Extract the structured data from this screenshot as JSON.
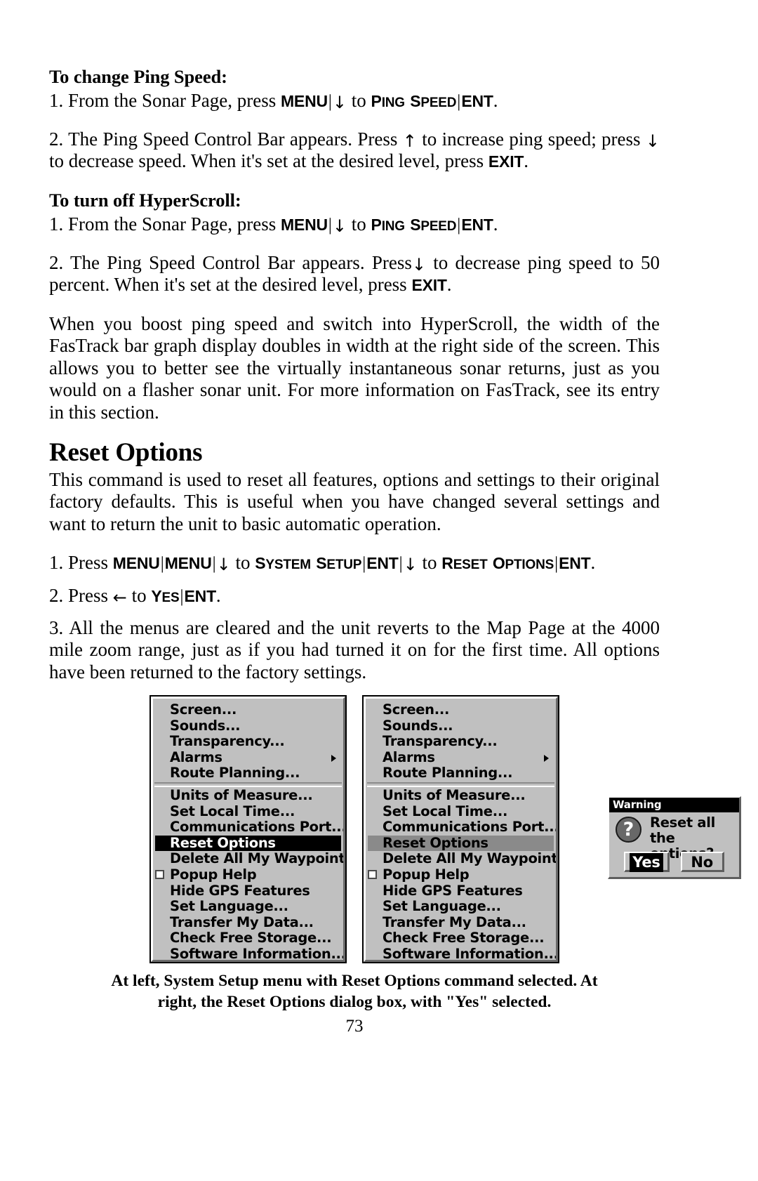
{
  "sections": [
    {
      "heading": "To change Ping Speed:",
      "steps": [
        {
          "prefix": "1. From the Sonar Page, press ",
          "keys": [
            "MENU",
            "↓",
            "PING SPEED",
            "ENT"
          ],
          "mid": " to ",
          "suffix": "."
        },
        {
          "text_full": "2. The Ping Speed Control Bar appears. Press ↑ to increase ping speed; press ↓ to decrease speed. When it's set at the desired level, press EXIT."
        }
      ]
    },
    {
      "heading": "To turn off HyperScroll:",
      "steps": [
        {
          "prefix": "1. From the Sonar Page, press ",
          "keys": [
            "MENU",
            "↓",
            "PING SPEED",
            "ENT"
          ],
          "mid": " to ",
          "suffix": "."
        },
        {
          "text_full": "2. The Ping Speed Control Bar appears. Press↓ to decrease ping speed to 50 percent. When it's set at the desired level, press EXIT."
        }
      ]
    }
  ],
  "paragraph_hyperscroll": "When you boost ping speed and switch into HyperScroll, the width of the FasTrack bar graph display doubles in width at the right side of the screen. This allows you to better see the virtually instantaneous sonar returns, just as you would on a flasher sonar unit. For more information on FasTrack, see its entry in this section.",
  "reset_section": {
    "title": "Reset Options",
    "intro": "This command is used to reset all features, options and settings to their original factory defaults. This is useful when you have changed several settings and want to return the unit to basic automatic operation.",
    "step1": {
      "prefix": "1. Press ",
      "k_menu1": "MENU",
      "k_menu2": "MENU",
      "k_down1": "↓",
      "to1": " to ",
      "k_system_setup": "SYSTEM SETUP",
      "k_ent1": "ENT",
      "k_down2": "↓",
      "to2": " to ",
      "k_reset_options": "RESET OPTIONS",
      "k_ent2": "ENT",
      "suffix": "."
    },
    "step2": {
      "prefix": "2. Press ",
      "arrow": "←",
      "mid": " to ",
      "k_yes": "YES",
      "k_ent": "ENT",
      "suffix": "."
    },
    "step3": "3. All the menus are cleared and the unit reverts to the Map Page at the 4000 mile zoom range, just as if you had turned it on for the first time. All options have been returned to the factory settings."
  },
  "menu": {
    "group1": [
      {
        "label": "Screen...",
        "submenu": false,
        "checkbox": false
      },
      {
        "label": "Sounds...",
        "submenu": false,
        "checkbox": false
      },
      {
        "label": "Transparency...",
        "submenu": false,
        "checkbox": false
      },
      {
        "label": "Alarms",
        "submenu": true,
        "checkbox": false
      },
      {
        "label": "Route Planning...",
        "submenu": false,
        "checkbox": false
      }
    ],
    "group2": [
      {
        "label": "Units of Measure...",
        "submenu": false,
        "checkbox": false,
        "selected": false
      },
      {
        "label": "Set Local Time...",
        "submenu": false,
        "checkbox": false,
        "selected": false
      },
      {
        "label": "Communications Port...",
        "submenu": false,
        "checkbox": false,
        "selected": false
      },
      {
        "label": "Reset Options",
        "submenu": false,
        "checkbox": false,
        "selected": true
      },
      {
        "label": "Delete All My Waypoints",
        "submenu": false,
        "checkbox": false,
        "selected": false
      },
      {
        "label": "Popup Help",
        "submenu": false,
        "checkbox": true,
        "selected": false
      },
      {
        "label": "Hide GPS Features",
        "submenu": false,
        "checkbox": false,
        "selected": false
      },
      {
        "label": "Set Language...",
        "submenu": false,
        "checkbox": false,
        "selected": false
      },
      {
        "label": "Transfer My Data...",
        "submenu": false,
        "checkbox": false,
        "selected": false
      },
      {
        "label": "Check Free Storage...",
        "submenu": false,
        "checkbox": false,
        "selected": false
      },
      {
        "label": "Software Information...",
        "submenu": false,
        "checkbox": false,
        "selected": false
      }
    ]
  },
  "dialog": {
    "title": "Warning",
    "icon": "question-mark",
    "message_line1": "Reset all the",
    "message_line2": "options?",
    "yes_label": "Yes",
    "no_label": "No",
    "selected_button": "Yes"
  },
  "caption": {
    "line1": "At left, System Setup menu with Reset Options command selected. At",
    "line2": "right, the Reset Options dialog box, with \"Yes\" selected."
  },
  "page_number": "73",
  "colors": {
    "menu_background": "#c0c0c0",
    "selection_background": "#000000",
    "selection_text": "#ffffff",
    "page_background": "#ffffff",
    "text": "#000000"
  }
}
